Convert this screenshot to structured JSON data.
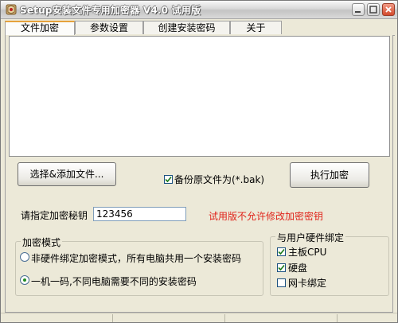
{
  "window": {
    "title": "Setup安装文件专用加密器 V4.0 试用版"
  },
  "tabs": [
    {
      "label": "文件加密",
      "active": true
    },
    {
      "label": "参数设置",
      "active": false
    },
    {
      "label": "创建安装密码",
      "active": false
    },
    {
      "label": "关于",
      "active": false
    }
  ],
  "file_panel": {
    "select_button": "选择&添加文件...",
    "backup_checkbox": {
      "label": "备份原文件为(*.bak)",
      "checked": true
    },
    "encrypt_button": "执行加密",
    "key_label": "请指定加密秘钥",
    "key_value": "123456",
    "trial_notice": "试用版不允许修改加密密钥",
    "trial_notice_color": "#e0241b"
  },
  "encrypt_mode": {
    "title": "加密模式",
    "options": [
      {
        "label": "非硬件绑定加密模式，所有电脑共用一个安装密码",
        "selected": false
      },
      {
        "label": "一机一码,不同电脑需要不同的安装密码",
        "selected": true
      }
    ]
  },
  "hardware_bind": {
    "title": "与用户硬件绑定",
    "options": [
      {
        "label": "主板CPU",
        "checked": true
      },
      {
        "label": "硬盘",
        "checked": true
      },
      {
        "label": "网卡绑定",
        "checked": false
      }
    ]
  }
}
